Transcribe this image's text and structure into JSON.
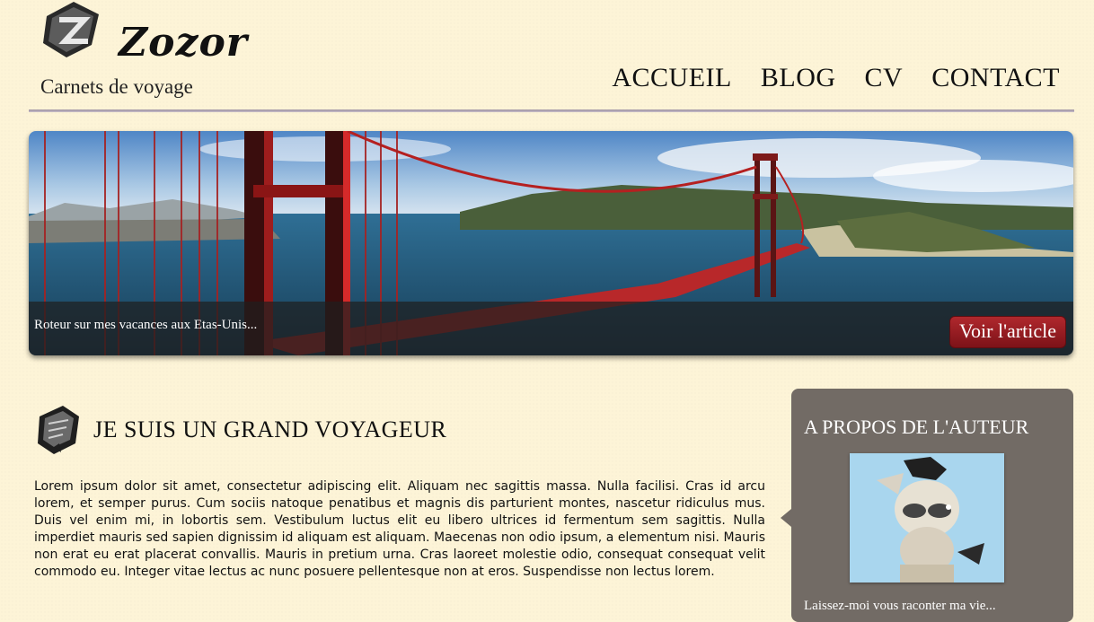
{
  "header": {
    "brand": "Zozor",
    "tagline": "Carnets de voyage",
    "logo_icon": "zozor-logo-icon",
    "nav": [
      "ACCUEIL",
      "BLOG",
      "CV",
      "CONTACT"
    ]
  },
  "banner": {
    "caption": "Roteur sur mes vacances aux Etas-Unis...",
    "button_label": "Voir l'article",
    "image": "golden-gate-bridge-photo"
  },
  "article": {
    "title": "JE SUIS UN GRAND VOYAGEUR",
    "icon": "notebook-icon",
    "body": "Lorem ipsum dolor sit amet, consectetur adipiscing elit. Aliquam nec sagittis massa. Nulla facilisi. Cras id arcu lorem, et semper purus. Cum sociis natoque penatibus et magnis dis parturient montes, nascetur ridiculus mus. Duis vel enim mi, in lobortis sem. Vestibulum luctus elit eu libero ultrices id fermentum sem sagittis. Nulla imperdiet mauris sed sapien dignissim id aliquam est aliquam. Maecenas non odio ipsum, a elementum nisi. Mauris non erat eu erat placerat convallis. Mauris in pretium urna. Cras laoreet molestie odio, consequat consequat velit commodo eu. Integer vitae lectus ac nunc posuere pellentesque non at eros. Suspendisse non lectus lorem."
  },
  "sidebar": {
    "title": "A PROPOS DE L'AUTEUR",
    "photo": "zozor-avatar",
    "text": "Laissez-moi vous raconter ma vie..."
  },
  "colors": {
    "background": "#fdf4d7",
    "accent_red": "#a3212a",
    "sidebar": "#726b65"
  }
}
